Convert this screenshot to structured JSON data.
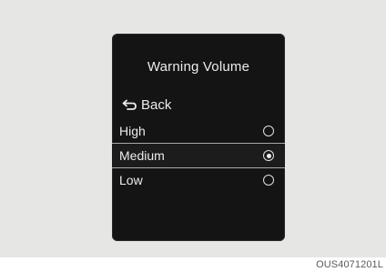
{
  "screen": {
    "title": "Warning Volume",
    "back_label": "Back",
    "back_icon": "back-arrow-icon",
    "options": [
      {
        "label": "High",
        "selected": false
      },
      {
        "label": "Medium",
        "selected": true
      },
      {
        "label": "Low",
        "selected": false
      }
    ]
  },
  "caption": "OUS4071201L",
  "colors": {
    "screen_background": "#141414",
    "frame_background": "#e6e6e4",
    "text": "#ececec",
    "divider": "#a8a8a8"
  }
}
